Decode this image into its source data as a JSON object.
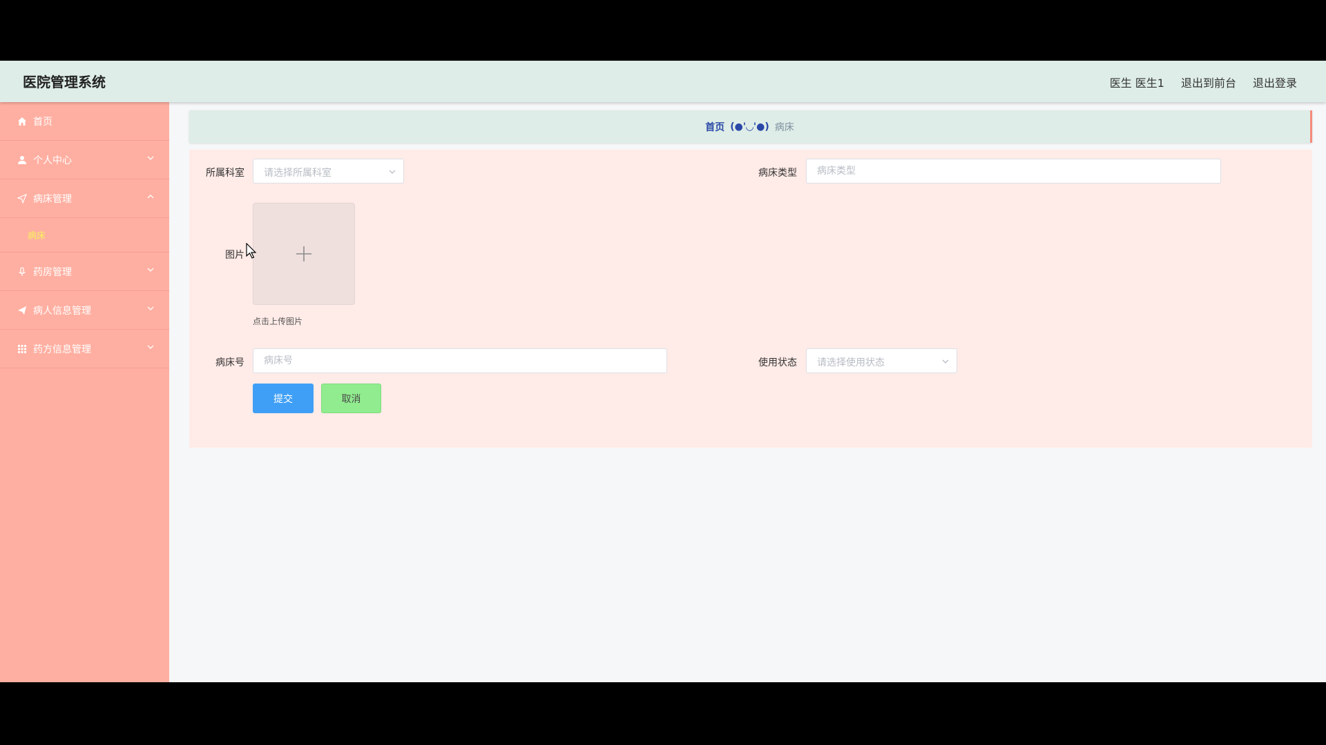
{
  "header": {
    "title": "医院管理系统",
    "user": "医生 医生1",
    "to_front": "退出到前台",
    "logout": "退出登录"
  },
  "sidebar": {
    "items": [
      {
        "label": "首页",
        "icon": "home-icon"
      },
      {
        "label": "个人中心",
        "icon": "user-icon"
      },
      {
        "label": "病床管理",
        "icon": "send-icon",
        "expanded": true,
        "children": [
          {
            "label": "病床"
          }
        ]
      },
      {
        "label": "药房管理",
        "icon": "mic-icon"
      },
      {
        "label": "病人信息管理",
        "icon": "paper-plane-icon"
      },
      {
        "label": "药方信息管理",
        "icon": "grid-icon"
      }
    ]
  },
  "breadcrumb": {
    "home": "首页",
    "separator": "(●'◡'●)",
    "current": "病床"
  },
  "form": {
    "department_label": "所属科室",
    "department_placeholder": "请选择所属科室",
    "bed_type_label": "病床类型",
    "bed_type_placeholder": "病床类型",
    "image_label": "图片",
    "upload_tip": "点击上传图片",
    "bed_no_label": "病床号",
    "bed_no_placeholder": "病床号",
    "status_label": "使用状态",
    "status_placeholder": "请选择使用状态",
    "submit": "提交",
    "cancel": "取消"
  },
  "colors": {
    "header_bg": "#deede7",
    "sidebar_bg": "#ffafa1",
    "panel_bg": "#ffebe7",
    "submit_btn": "#3f9ff6",
    "cancel_btn": "#90ec8e",
    "active_submenu": "#f7f25c"
  }
}
